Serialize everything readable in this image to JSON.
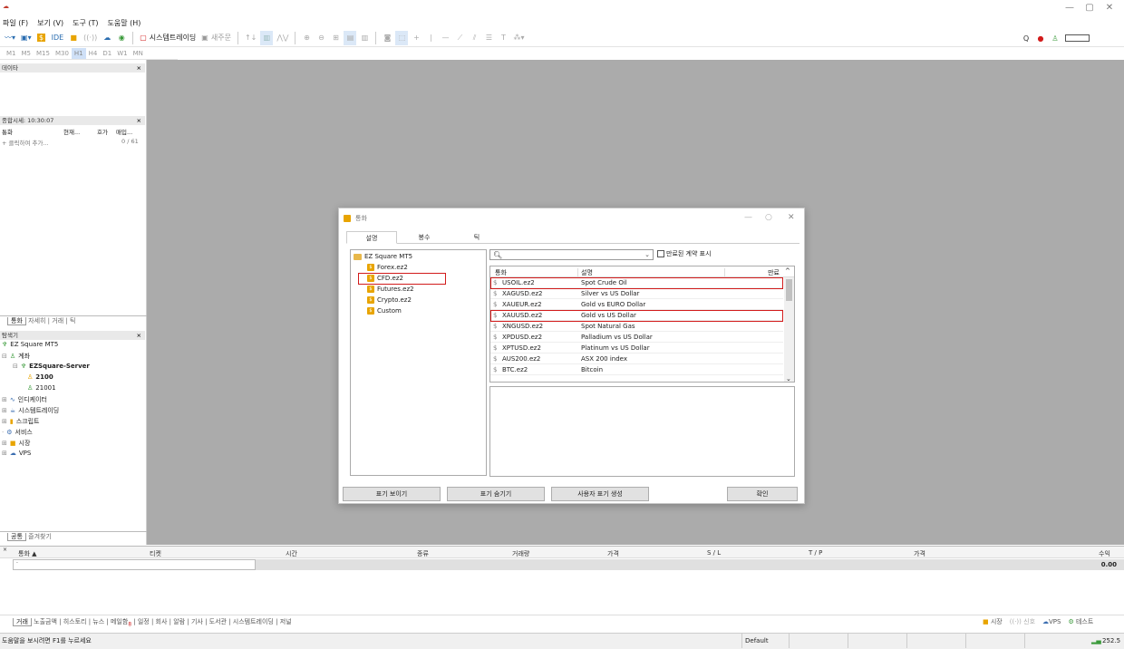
{
  "app": {
    "logo": "☁"
  },
  "menu": [
    "파일 (F)",
    "보기 (V)",
    "도구 (T)",
    "도움말 (H)"
  ],
  "toolbar": {
    "ide_label": "IDE",
    "algo_trading": "시스템트레이딩",
    "new_order": "새주문",
    "zoom_search": "Q"
  },
  "timeframes": [
    "M1",
    "M5",
    "M15",
    "M30",
    "H1",
    "H4",
    "D1",
    "W1",
    "MN"
  ],
  "panels": {
    "data_window": "데이타",
    "market_watch_title": "종합시세: 10:30:07",
    "mw_cols": [
      "통화",
      "현재...",
      "호가",
      "매입..."
    ],
    "mw_add": "+ 클릭하여 추가...",
    "mw_count": "0 / 61",
    "mw_tabs": [
      "통화",
      "자세히",
      "거래",
      "틱"
    ],
    "navigator_title": "탐색기",
    "nav": {
      "root": "EZ Square MT5",
      "accounts": "계좌",
      "server": "EZSquare-Server",
      "acc1": "2100",
      "acc2": "21001",
      "indicators": "인디케이터",
      "experts": "시스템트레이딩",
      "scripts": "스크립트",
      "services": "서비스",
      "market": "시장",
      "vps": "VPS"
    },
    "nav_tabs": [
      "공통",
      "즐겨찾기"
    ]
  },
  "terminal": {
    "headers": [
      "통화 ▲",
      "티켓",
      "시간",
      "종류",
      "거래량",
      "가격",
      "S / L",
      "T / P",
      "가격",
      "수익"
    ],
    "profit_value": "0.00",
    "tabs_active": "거래",
    "tabs": [
      "노출금액",
      "히스토리",
      "뉴스",
      "메일함",
      "일정",
      "회사",
      "알람",
      "기사",
      "도서관",
      "시스템트레이딩",
      "저널"
    ],
    "mail_badge": "8"
  },
  "statusbar": {
    "help": "도움말을 보시려면 F1를 누르세요",
    "profile": "Default",
    "right_links": [
      "시장",
      "신호",
      "VPS",
      "테스트"
    ],
    "ping": "252.5"
  },
  "dialog": {
    "title": "통화",
    "tabs": [
      "설명",
      "봉수",
      "틱"
    ],
    "tree_root": "EZ Square MT5",
    "tree_items": [
      "Forex.ez2",
      "CFD.ez2",
      "Futures.ez2",
      "Crypto.ez2",
      "Custom"
    ],
    "search_placeholder": "",
    "show_expired": "만료된 계약 표시",
    "table_headers": [
      "통화",
      "설명",
      "만료"
    ],
    "rows": [
      {
        "symbol": "USOIL.ez2",
        "desc": "Spot Crude Oil"
      },
      {
        "symbol": "XAGUSD.ez2",
        "desc": "Silver vs US Dollar"
      },
      {
        "symbol": "XAUEUR.ez2",
        "desc": "Gold vs EURO Dollar"
      },
      {
        "symbol": "XAUUSD.ez2",
        "desc": "Gold vs US Dollar"
      },
      {
        "symbol": "XNGUSD.ez2",
        "desc": "Spot Natural Gas"
      },
      {
        "symbol": "XPDUSD.ez2",
        "desc": "Palladium vs US Dollar"
      },
      {
        "symbol": "XPTUSD.ez2",
        "desc": "Platinum vs US Dollar"
      },
      {
        "symbol": "AUS200.ez2",
        "desc": "ASX 200 index"
      },
      {
        "symbol": "BTC.ez2",
        "desc": "Bitcoin"
      }
    ],
    "buttons": [
      "표기 보이기",
      "표기 숨기기",
      "사용자 표기 생성",
      "확인"
    ]
  },
  "colors": {
    "highlight": "#d21b1b",
    "chart_bg": "#ababab"
  }
}
